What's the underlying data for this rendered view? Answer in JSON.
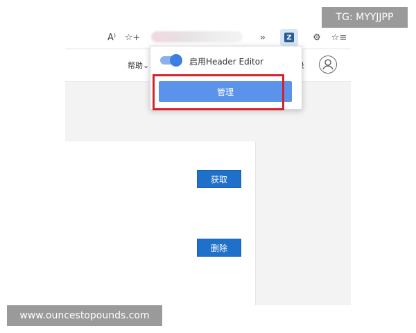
{
  "toolbar": {
    "read_aloud_icon": "A⁾",
    "favorite_add_icon": "☆+",
    "extension_arrow_icon": "»",
    "extension_icon_letter": "Z",
    "puzzle_icon": "⚙",
    "favorites_icon": "☆≡"
  },
  "site_header": {
    "help_label": "帮助⌄",
    "login_label": "录"
  },
  "popup": {
    "toggle_label": "启用Header Editor",
    "toggle_on": true,
    "manage_label": "管理"
  },
  "content": {
    "fetch_label": "获取",
    "delete_label": "删除"
  },
  "watermarks": {
    "top": "TG: MYYJJPP",
    "bottom": "www.ouncestopounds.com"
  },
  "colors": {
    "primary_button": "#1e70c9",
    "manage_button": "#5b93eb",
    "highlight_border": "#d4222a",
    "toggle_on": "#3d7fe0"
  }
}
